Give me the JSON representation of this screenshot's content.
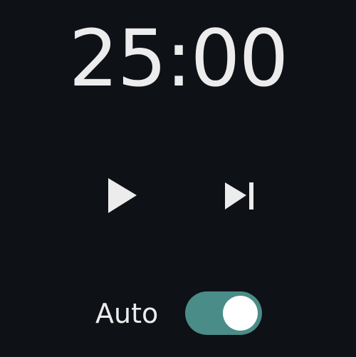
{
  "timer": {
    "time": "25:00"
  },
  "controls": {
    "play_icon": "play-icon",
    "skip_icon": "skip-next-icon"
  },
  "auto": {
    "label": "Auto",
    "enabled": true
  },
  "colors": {
    "background": "#0e1116",
    "text": "#ececec",
    "toggle_on": "#4a8c88",
    "knob": "#ffffff"
  }
}
